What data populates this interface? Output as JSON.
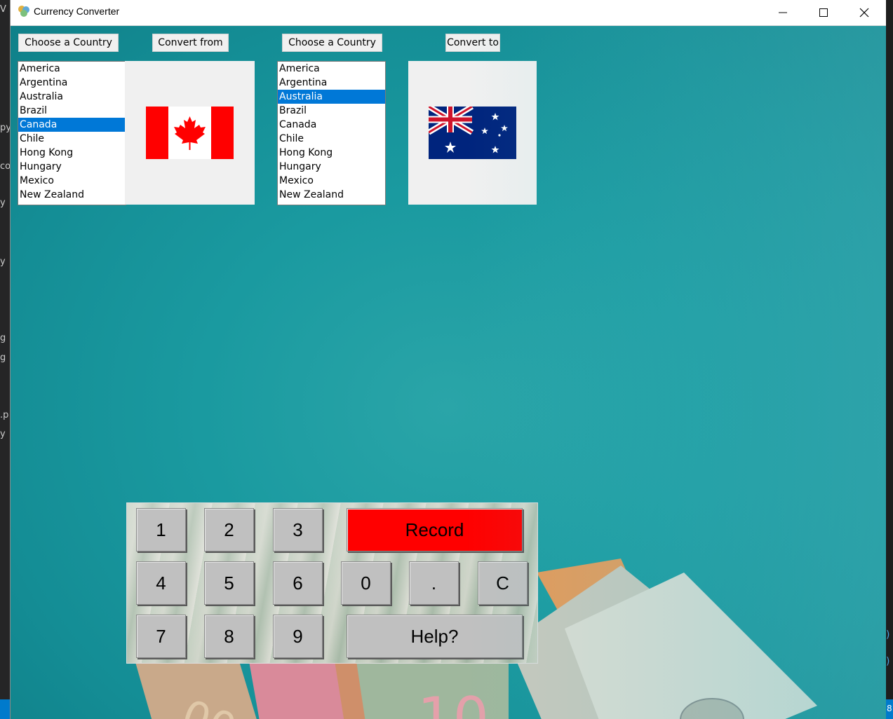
{
  "window": {
    "title": "Currency Converter"
  },
  "from": {
    "choose_label": "Choose a Country",
    "convert_label": "Convert from",
    "countries": [
      "America",
      "Argentina",
      "Australia",
      "Brazil",
      "Canada",
      "Chile",
      "Hong Kong",
      "Hungary",
      "Mexico",
      "New Zealand"
    ],
    "selected": "Canada",
    "flag": "canada-flag"
  },
  "to": {
    "choose_label": "Choose a Country",
    "convert_label": "Convert to",
    "countries": [
      "America",
      "Argentina",
      "Australia",
      "Brazil",
      "Canada",
      "Chile",
      "Hong Kong",
      "Hungary",
      "Mexico",
      "New Zealand"
    ],
    "selected": "Australia",
    "flag": "australia-flag"
  },
  "keypad": {
    "keys": [
      "1",
      "2",
      "3",
      "4",
      "5",
      "6",
      "0",
      ".",
      "C",
      "7",
      "8",
      "9"
    ],
    "record_label": "Record",
    "help_label": "Help?"
  },
  "colors": {
    "selection": "#0078d7",
    "record": "#ff0000",
    "button_gray": "#c0c0c0",
    "teal_bg": "#1a9aa0"
  }
}
